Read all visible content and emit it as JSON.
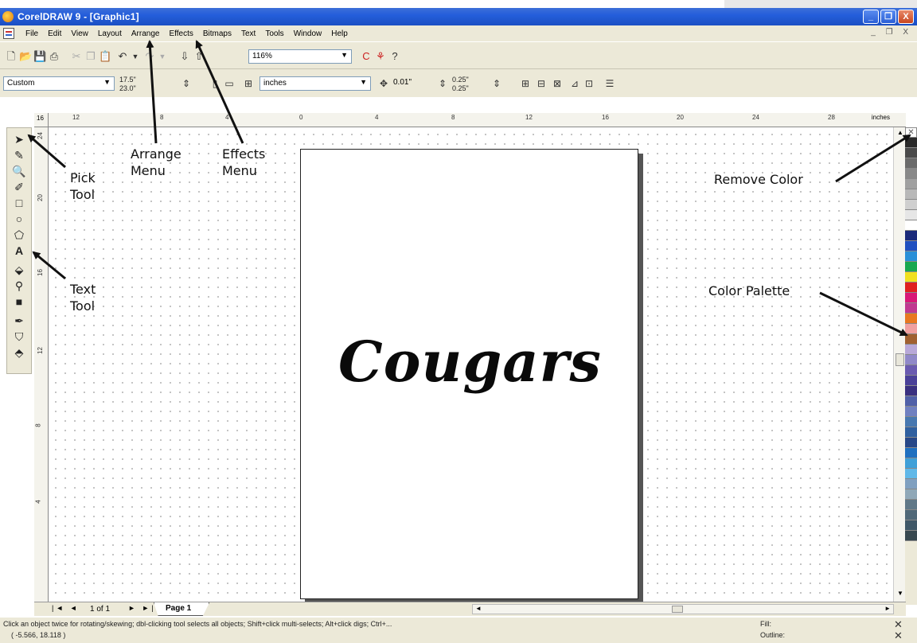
{
  "window": {
    "title": "CorelDRAW 9 - [Graphic1]",
    "min_glyph": "_",
    "max_glyph": "❐",
    "close_glyph": "X",
    "doc_controls": "_ ❐ X"
  },
  "menu": [
    "File",
    "Edit",
    "View",
    "Layout",
    "Arrange",
    "Effects",
    "Bitmaps",
    "Text",
    "Tools",
    "Window",
    "Help"
  ],
  "toolbar": {
    "zoom_value": "116%"
  },
  "propbar": {
    "paper_type": "Custom",
    "width_value": "17.5\"",
    "height_value": "23.0\"",
    "units_value": "inches",
    "nudge_value": "0.01\"",
    "dup_x": "0.25\"",
    "dup_y": "0.25\""
  },
  "ruler": {
    "top_labels": [
      "16",
      "12",
      "8",
      "4",
      "0",
      "4",
      "8",
      "12",
      "16",
      "20",
      "24",
      "28"
    ],
    "units": "inches",
    "left_labels": [
      "24",
      "20",
      "16",
      "12",
      "8",
      "4"
    ]
  },
  "page": {
    "text": "Cougars"
  },
  "page_nav": {
    "first_prev": "|◄ ◄",
    "count": "1 of 1",
    "next_last": "► ►|",
    "tab": "Page 1"
  },
  "status": {
    "message": "Click an object twice for rotating/skewing; dbl-clicking tool selects all objects; Shift+click multi-selects; Alt+click digs; Ctrl+...",
    "coords": "( -5.566, 18.118 )",
    "fill": "Fill:",
    "outline": "Outline:"
  },
  "callouts": {
    "pick": [
      "Pick",
      "Tool"
    ],
    "text": [
      "Text",
      "Tool"
    ],
    "arrange": [
      "Arrange",
      "Menu"
    ],
    "effects": [
      "Effects",
      "Menu"
    ],
    "remove_color": "Remove Color",
    "color_palette": "Color Palette"
  },
  "icons": {
    "tools": [
      "pick-icon",
      "shape-icon",
      "zoom-icon",
      "freehand-icon",
      "rectangle-icon",
      "ellipse-icon",
      "polygon-icon",
      "text-icon",
      "interactive-fill-icon",
      "eyedropper-icon",
      "artistic-media-icon",
      "outline-icon",
      "fill-icon",
      "interactive-blend-icon"
    ]
  },
  "palette": [
    "#2a2a2a",
    "#4a4a4a",
    "#6a6a6a",
    "#888888",
    "#a0a0a0",
    "#b8b8b8",
    "#cfcfcf",
    "#e6e6e6",
    "#ffffff",
    "#1a2a7a",
    "#2050c0",
    "#2a90d8",
    "#18a850",
    "#f0e020",
    "#e02020",
    "#d81878",
    "#c03890",
    "#e87820",
    "#f0a0a0",
    "#a06030",
    "#b8a8d8",
    "#9088c8",
    "#6a5ab0",
    "#4a4098",
    "#3a3080",
    "#5060a8",
    "#7080c0",
    "#4878b0",
    "#3060a0",
    "#284888",
    "#2070c0",
    "#40a0d8",
    "#60b8e8",
    "#80a0c0",
    "#90a8b8",
    "#607888",
    "#506878",
    "#405868",
    "#384850"
  ]
}
